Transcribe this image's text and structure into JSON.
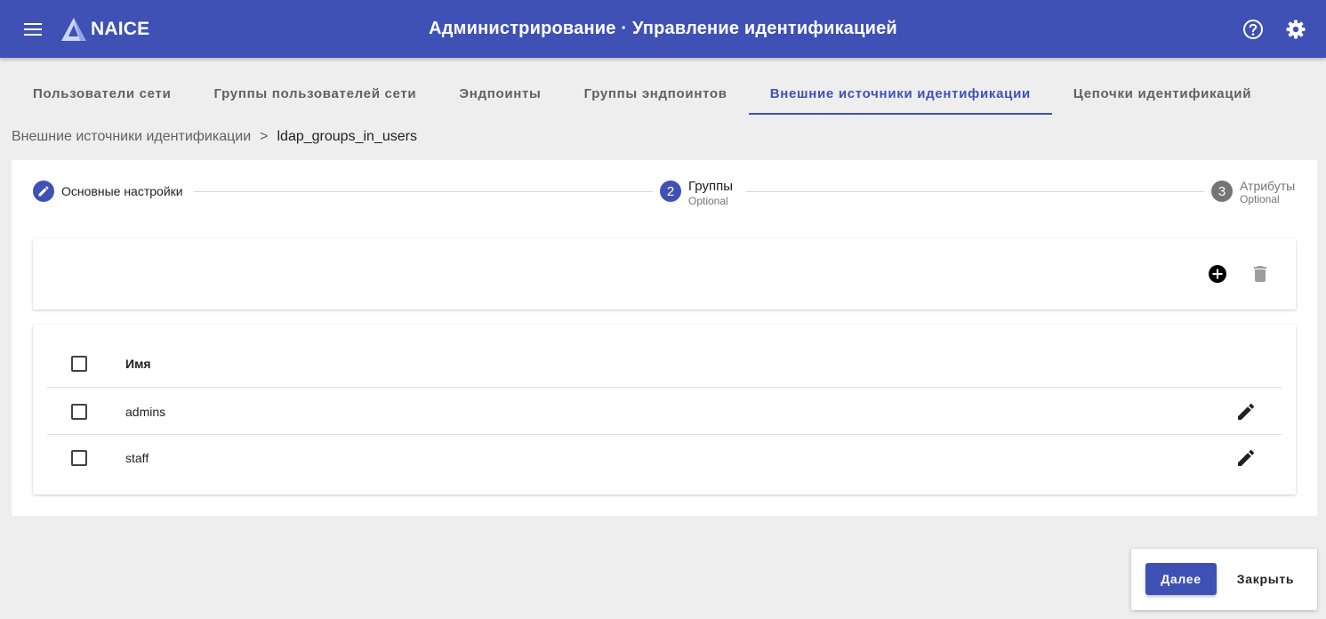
{
  "header": {
    "app_name": "NAICE",
    "page_title": "Администрирование · Управление идентификацией"
  },
  "icons": {
    "menu": "menu-icon",
    "logo": "naice-logo",
    "help": "help-circle-icon",
    "settings": "gear-icon",
    "step_done": "pencil-icon",
    "add": "add-circle-icon",
    "delete": "trash-icon",
    "edit": "pencil-icon"
  },
  "tabs": [
    {
      "label": "Пользователи сети",
      "active": false
    },
    {
      "label": "Группы пользователей сети",
      "active": false
    },
    {
      "label": "Эндпоинты",
      "active": false
    },
    {
      "label": "Группы эндпоинтов",
      "active": false
    },
    {
      "label": "Внешние источники идентификации",
      "active": true
    },
    {
      "label": "Цепочки идентификаций",
      "active": false
    }
  ],
  "breadcrumb": {
    "parent": "Внешние источники идентификации",
    "separator": ">",
    "current": "ldap_groups_in_users"
  },
  "stepper": {
    "steps": [
      {
        "label": "Основные настройки",
        "number": "",
        "sub": "",
        "state": "completed"
      },
      {
        "label": "Группы",
        "number": "2",
        "sub": "Optional",
        "state": "active"
      },
      {
        "label": "Атрибуты",
        "number": "3",
        "sub": "Optional",
        "state": "pending"
      }
    ]
  },
  "table": {
    "columns": [
      "Имя"
    ],
    "rows": [
      {
        "name": "admins"
      },
      {
        "name": "staff"
      }
    ]
  },
  "footer": {
    "next_label": "Далее",
    "close_label": "Закрыть"
  },
  "colors": {
    "primary": "#3f51b5",
    "background": "#eeeeee",
    "step_pending": "#757575"
  }
}
